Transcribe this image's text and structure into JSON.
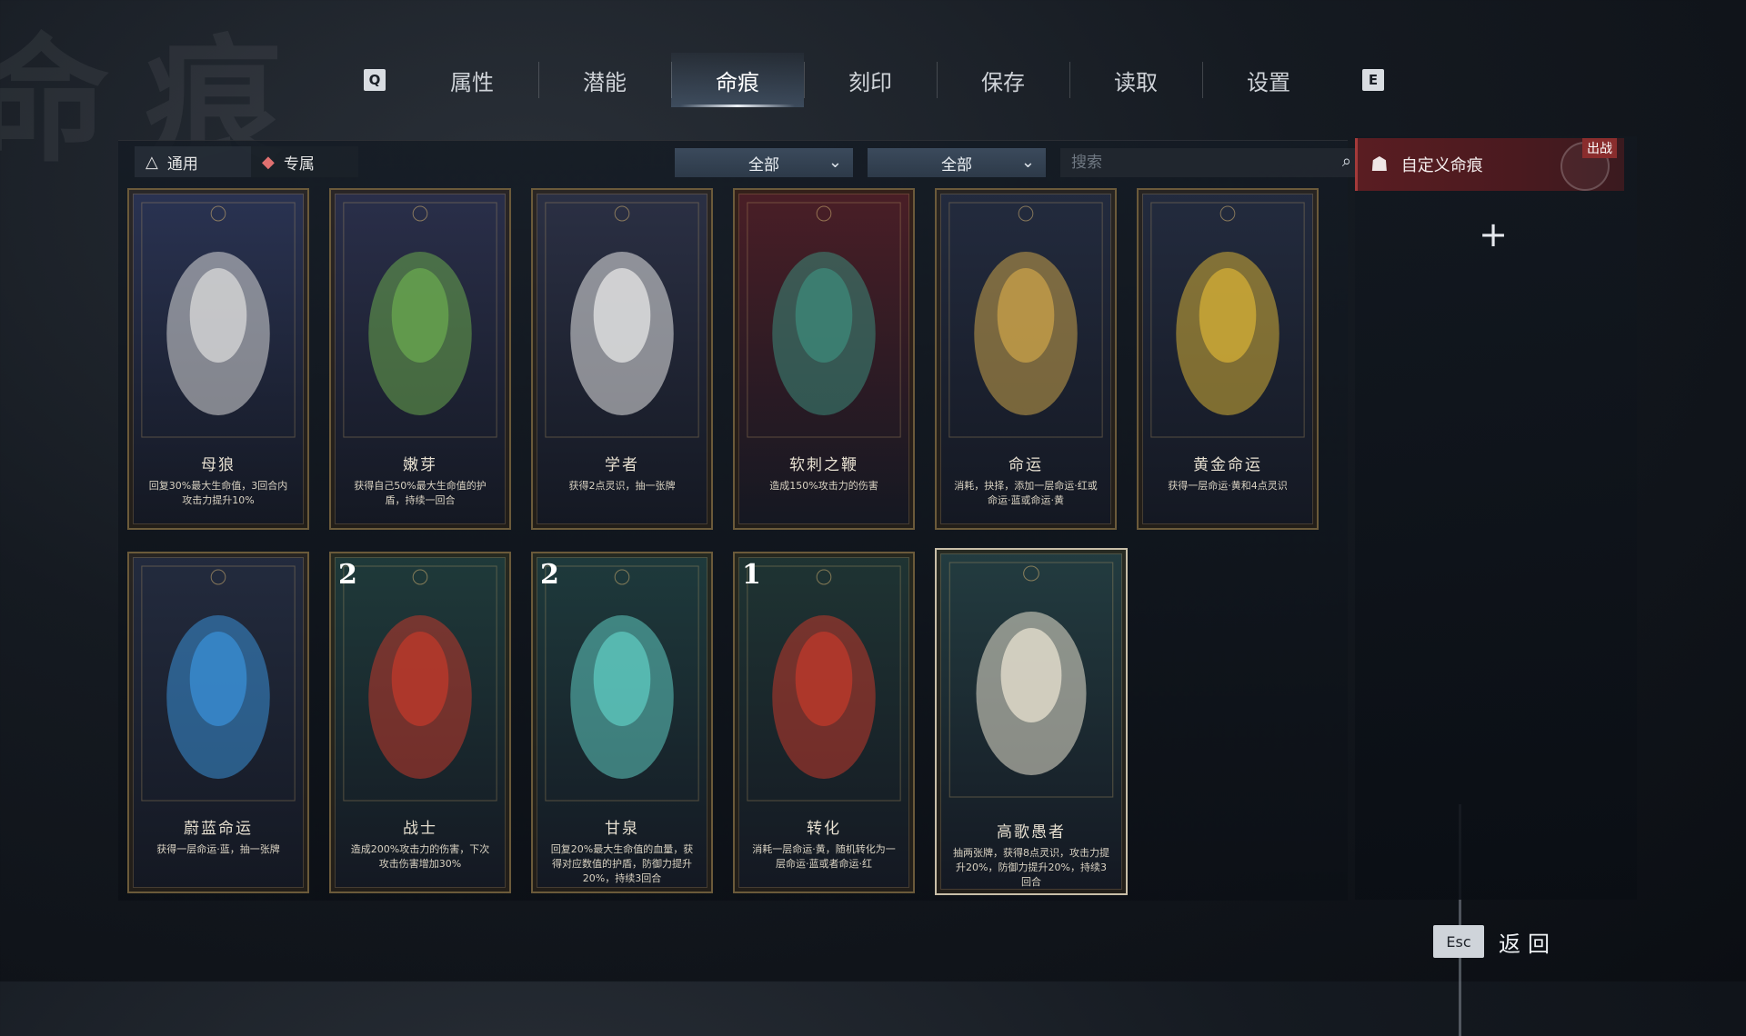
{
  "background_title": "命痕",
  "nav": {
    "left_key": "Q",
    "right_key": "E",
    "tabs": [
      "属性",
      "潜能",
      "命痕",
      "刻印",
      "保存",
      "读取",
      "设置"
    ],
    "active_index": 2
  },
  "filters": {
    "tab_general": "通用",
    "tab_exclusive": "专属",
    "dropdown1": "全部",
    "dropdown2": "全部",
    "search_placeholder": "搜索"
  },
  "cards": [
    {
      "name": "母狼",
      "desc": "回复30%最大生命值，3回合内攻击力提升10%",
      "count": "",
      "palette": "#2a3352",
      "art": "#d9d9d9"
    },
    {
      "name": "嫩芽",
      "desc": "获得自己50%最大生命值的护盾，持续一回合",
      "count": "",
      "palette": "#2a2f4a",
      "art": "#6aa84f"
    },
    {
      "name": "学者",
      "desc": "获得2点灵识，抽一张牌",
      "count": "",
      "palette": "#2b3044",
      "art": "#e6e6e6"
    },
    {
      "name": "软刺之鞭",
      "desc": "造成150%攻击力的伤害",
      "count": "",
      "palette": "#4a1e26",
      "art": "#3d8a7a"
    },
    {
      "name": "命运",
      "desc": "消耗，抉择，添加一层命运·红或命运·蓝或命运·黄",
      "count": "",
      "palette": "#232b3e",
      "art": "#c9a24a"
    },
    {
      "name": "黄金命运",
      "desc": "获得一层命运·黄和4点灵识",
      "count": "",
      "palette": "#232b3e",
      "art": "#d4af37"
    },
    {
      "name": "蔚蓝命运",
      "desc": "获得一层命运·蓝，抽一张牌",
      "count": "",
      "palette": "#232b3e",
      "art": "#3a8fd6"
    },
    {
      "name": "战士",
      "desc": "造成200%攻击力的伤害，下次攻击伤害增加30%",
      "count": "2",
      "palette": "#1f3a3a",
      "art": "#c0392b"
    },
    {
      "name": "甘泉",
      "desc": "回复20%最大生命值的血量，获得对应数值的护盾，防御力提升20%，持续3回合",
      "count": "2",
      "palette": "#1e3a3c",
      "art": "#5fc9c0"
    },
    {
      "name": "转化",
      "desc": "消耗一层命运·黄，随机转化为一层命运·蓝或者命运·红",
      "count": "1",
      "palette": "#1f3433",
      "art": "#c0392b"
    },
    {
      "name": "高歌愚者",
      "desc": "抽两张牌，获得8点灵识，攻击力提升20%，防御力提升20%，持续3回合",
      "count": "",
      "palette": "#233c40",
      "art": "#e8e2d0"
    }
  ],
  "right_panel": {
    "custom_deck_label": "自定义命痕",
    "deploy_badge": "出战",
    "add_symbol": "+"
  },
  "footer": {
    "esc_key": "Esc",
    "back_label": "返回"
  },
  "colors": {
    "accent_red": "#5a1d22",
    "card_border": "#6b5a3a",
    "nav_active": "#6e8cad"
  }
}
